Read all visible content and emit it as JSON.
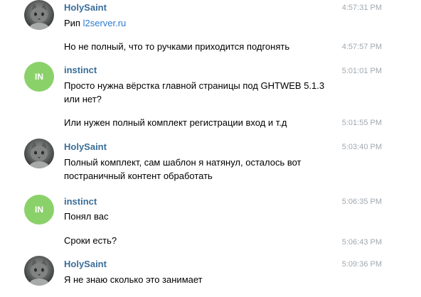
{
  "messages": [
    {
      "author": "HolySaint",
      "avatar": "cat-photo",
      "parts": [
        {
          "time": "4:57:31 PM",
          "text": "Рип ",
          "link": "l2server.ru"
        },
        {
          "time": "4:57:57 PM",
          "text": "Но не полный, что то ручками приходится подгонять"
        }
      ]
    },
    {
      "author": "instinct",
      "avatar_initials": "IN",
      "parts": [
        {
          "time": "5:01:01 PM",
          "text": "Просто нужна вёрстка главной страницы под GHTWEB 5.1.3 или нет?"
        },
        {
          "time": "5:01:55 PM",
          "text": "Или нужен полный комплект регистрации вход и т.д"
        }
      ]
    },
    {
      "author": "HolySaint",
      "avatar": "cat-photo",
      "parts": [
        {
          "time": "5:03:40 PM",
          "text": "Полный комплект, сам шаблон я натянул, осталось вот постраничный контент обработать"
        }
      ]
    },
    {
      "author": "instinct",
      "avatar_initials": "IN",
      "parts": [
        {
          "time": "5:06:35 PM",
          "text": "Понял вас"
        },
        {
          "time": "5:06:43 PM",
          "text": "Сроки есть?"
        }
      ]
    },
    {
      "author": "HolySaint",
      "avatar": "cat-photo",
      "parts": [
        {
          "time": "5:09:36 PM",
          "text": "Я не знаю сколько это занимает"
        }
      ]
    }
  ],
  "colors": {
    "author_name": "#3a6d99",
    "timestamp": "#a0a8b0",
    "link": "#2b7bd1",
    "initials_avatar": "#8bd16a"
  }
}
